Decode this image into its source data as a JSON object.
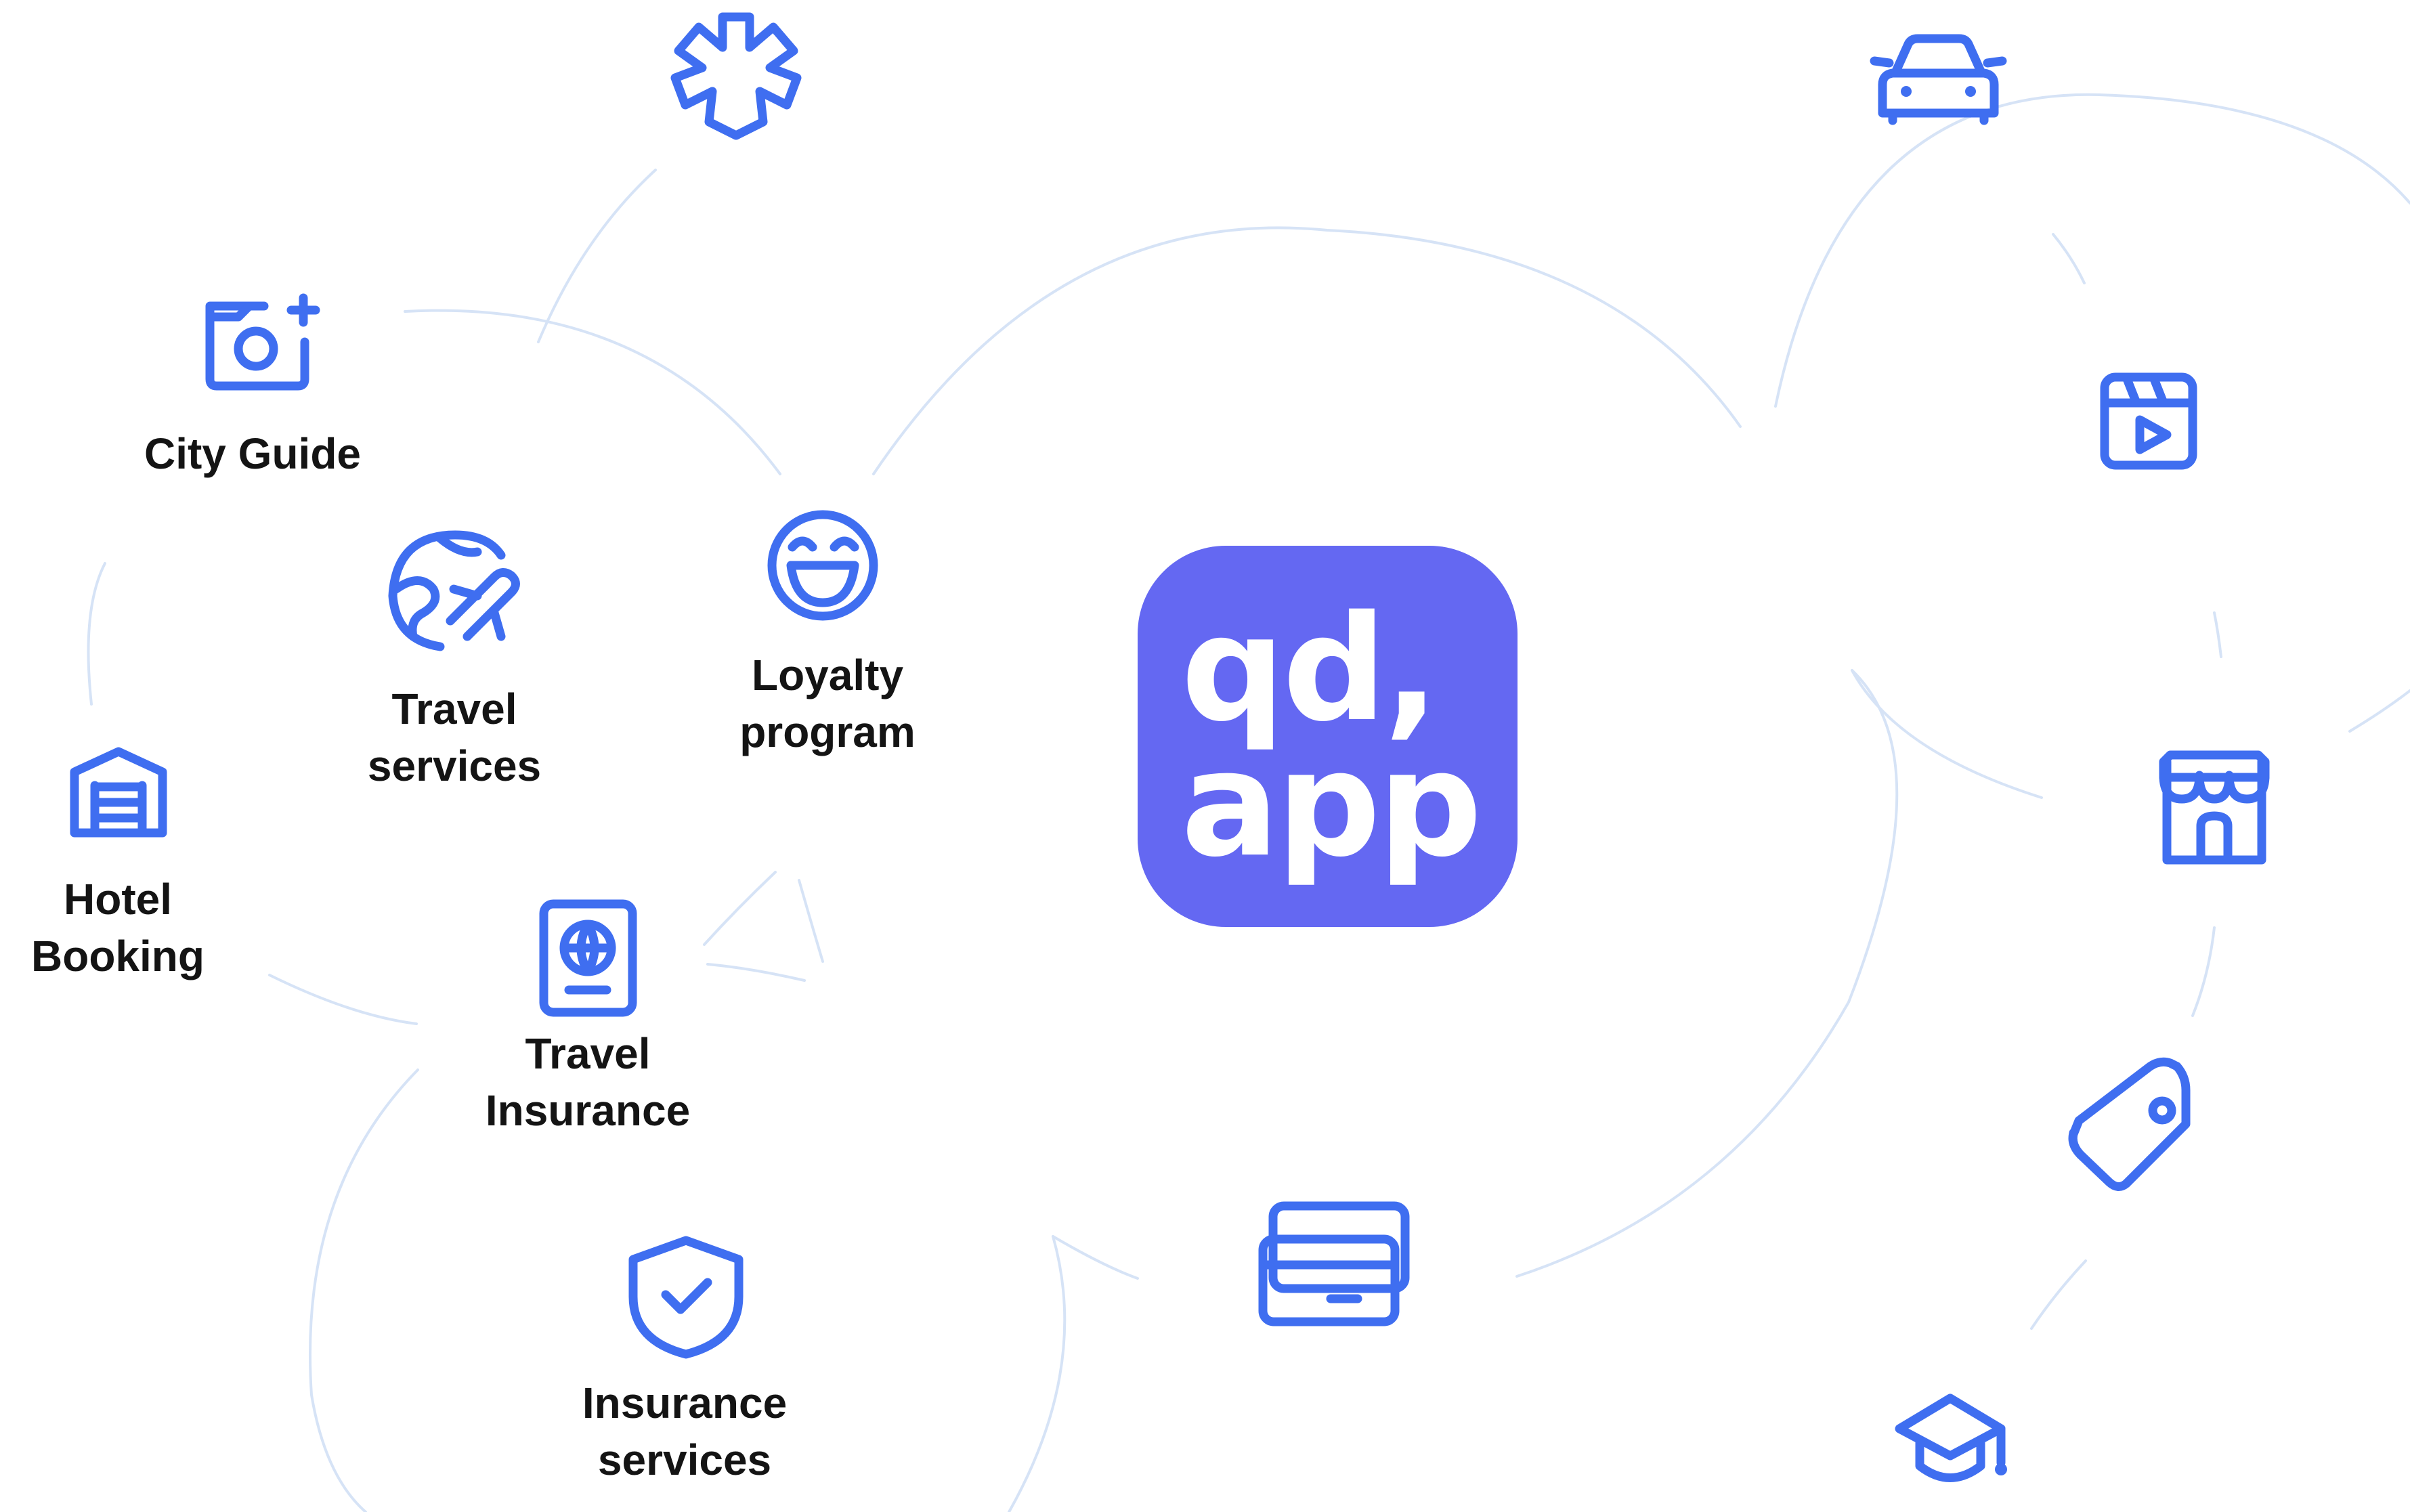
{
  "logo": {
    "line1": "qd,",
    "line2": "app",
    "color": "#6468f2"
  },
  "colors": {
    "icon_stroke": "#3f6ef0",
    "connector_arcs": "#d6e3f6",
    "label_text": "#141414",
    "background": "#ffffff"
  },
  "services": {
    "city_guide": {
      "icon": "camera-plus-icon",
      "label": "City Guide"
    },
    "travel_services": {
      "icon": "globe-plane-icon",
      "line1": "Travel",
      "line2": "services"
    },
    "loyalty_program": {
      "icon": "smiley-face-icon",
      "line1": "Loyalty",
      "line2": "program"
    },
    "hotel_booking": {
      "icon": "hotel-garage-icon",
      "line1": "Hotel",
      "line2": "Booking"
    },
    "travel_insurance": {
      "icon": "passport-icon",
      "line1": "Travel",
      "line2": "Insurance"
    },
    "insurance_services": {
      "icon": "shield-check-icon",
      "line1": "Insurance",
      "line2": "services"
    }
  },
  "unlabeled_icons": [
    "medical-asterisk-icon",
    "car-icon",
    "video-player-icon",
    "storefront-icon",
    "price-tag-icon",
    "graduation-cap-icon",
    "credit-cards-icon"
  ]
}
